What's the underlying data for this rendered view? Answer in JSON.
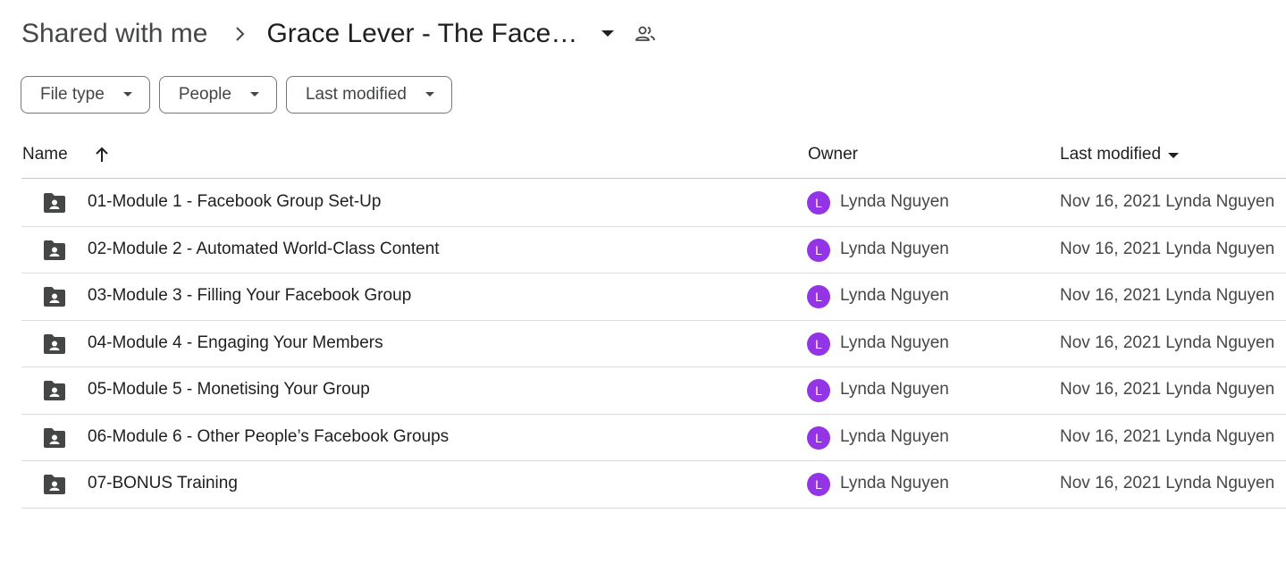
{
  "breadcrumb": {
    "root": "Shared with me",
    "current": "Grace Lever - The Face…"
  },
  "filters": [
    {
      "label": "File type"
    },
    {
      "label": "People"
    },
    {
      "label": "Last modified"
    }
  ],
  "table": {
    "headers": {
      "name": "Name",
      "owner": "Owner",
      "modified": "Last modified"
    },
    "rows": [
      {
        "name": "01-Module 1 - Facebook Group Set-Up",
        "avatar": "L",
        "owner": "Lynda Nguyen",
        "modified": "Nov 16, 2021 Lynda Nguyen"
      },
      {
        "name": "02-Module 2 - Automated World-Class Content",
        "avatar": "L",
        "owner": "Lynda Nguyen",
        "modified": "Nov 16, 2021 Lynda Nguyen"
      },
      {
        "name": "03-Module 3 - Filling Your Facebook Group",
        "avatar": "L",
        "owner": "Lynda Nguyen",
        "modified": "Nov 16, 2021 Lynda Nguyen"
      },
      {
        "name": "04-Module 4 - Engaging Your Members",
        "avatar": "L",
        "owner": "Lynda Nguyen",
        "modified": "Nov 16, 2021 Lynda Nguyen"
      },
      {
        "name": "05-Module 5 - Monetising Your Group",
        "avatar": "L",
        "owner": "Lynda Nguyen",
        "modified": "Nov 16, 2021 Lynda Nguyen"
      },
      {
        "name": "06-Module 6 - Other People’s Facebook Groups",
        "avatar": "L",
        "owner": "Lynda Nguyen",
        "modified": "Nov 16, 2021 Lynda Nguyen"
      },
      {
        "name": "07-BONUS Training",
        "avatar": "L",
        "owner": "Lynda Nguyen",
        "modified": "Nov 16, 2021 Lynda Nguyen"
      }
    ]
  },
  "icons": {
    "folder": "shared-folder-icon",
    "sort": "arrow-up-icon",
    "dropdown": "caret-down-icon",
    "shared": "people-icon",
    "separator": "chevron-right-icon"
  },
  "colors": {
    "avatar": "#9334e6",
    "folder": "#444746",
    "border": "#747775"
  }
}
